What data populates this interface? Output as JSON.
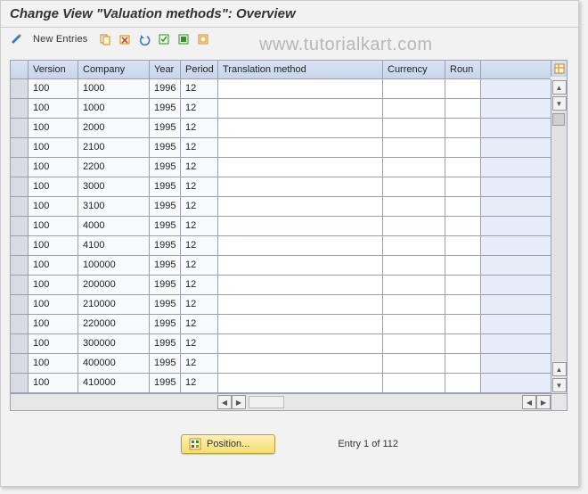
{
  "title": "Change View \"Valuation methods\": Overview",
  "watermark": "www.tutorialkart.com",
  "toolbar": {
    "new_entries_label": "New Entries"
  },
  "columns": {
    "version": "Version",
    "company": "Company",
    "year": "Year",
    "period": "Period",
    "translation_method": "Translation method",
    "currency": "Currency",
    "round": "Roun"
  },
  "rows": [
    {
      "version": "100",
      "company": "1000",
      "year": "1996",
      "period": "12",
      "translation_method": "",
      "currency": "",
      "round": ""
    },
    {
      "version": "100",
      "company": "1000",
      "year": "1995",
      "period": "12",
      "translation_method": "",
      "currency": "",
      "round": ""
    },
    {
      "version": "100",
      "company": "2000",
      "year": "1995",
      "period": "12",
      "translation_method": "",
      "currency": "",
      "round": ""
    },
    {
      "version": "100",
      "company": "2100",
      "year": "1995",
      "period": "12",
      "translation_method": "",
      "currency": "",
      "round": ""
    },
    {
      "version": "100",
      "company": "2200",
      "year": "1995",
      "period": "12",
      "translation_method": "",
      "currency": "",
      "round": ""
    },
    {
      "version": "100",
      "company": "3000",
      "year": "1995",
      "period": "12",
      "translation_method": "",
      "currency": "",
      "round": ""
    },
    {
      "version": "100",
      "company": "3100",
      "year": "1995",
      "period": "12",
      "translation_method": "",
      "currency": "",
      "round": ""
    },
    {
      "version": "100",
      "company": "4000",
      "year": "1995",
      "period": "12",
      "translation_method": "",
      "currency": "",
      "round": ""
    },
    {
      "version": "100",
      "company": "4100",
      "year": "1995",
      "period": "12",
      "translation_method": "",
      "currency": "",
      "round": ""
    },
    {
      "version": "100",
      "company": "100000",
      "year": "1995",
      "period": "12",
      "translation_method": "",
      "currency": "",
      "round": ""
    },
    {
      "version": "100",
      "company": "200000",
      "year": "1995",
      "period": "12",
      "translation_method": "",
      "currency": "",
      "round": ""
    },
    {
      "version": "100",
      "company": "210000",
      "year": "1995",
      "period": "12",
      "translation_method": "",
      "currency": "",
      "round": ""
    },
    {
      "version": "100",
      "company": "220000",
      "year": "1995",
      "period": "12",
      "translation_method": "",
      "currency": "",
      "round": ""
    },
    {
      "version": "100",
      "company": "300000",
      "year": "1995",
      "period": "12",
      "translation_method": "",
      "currency": "",
      "round": ""
    },
    {
      "version": "100",
      "company": "400000",
      "year": "1995",
      "period": "12",
      "translation_method": "",
      "currency": "",
      "round": ""
    },
    {
      "version": "100",
      "company": "410000",
      "year": "1995",
      "period": "12",
      "translation_method": "",
      "currency": "",
      "round": ""
    }
  ],
  "footer": {
    "position_label": "Position...",
    "entry_status": "Entry 1 of 112"
  }
}
